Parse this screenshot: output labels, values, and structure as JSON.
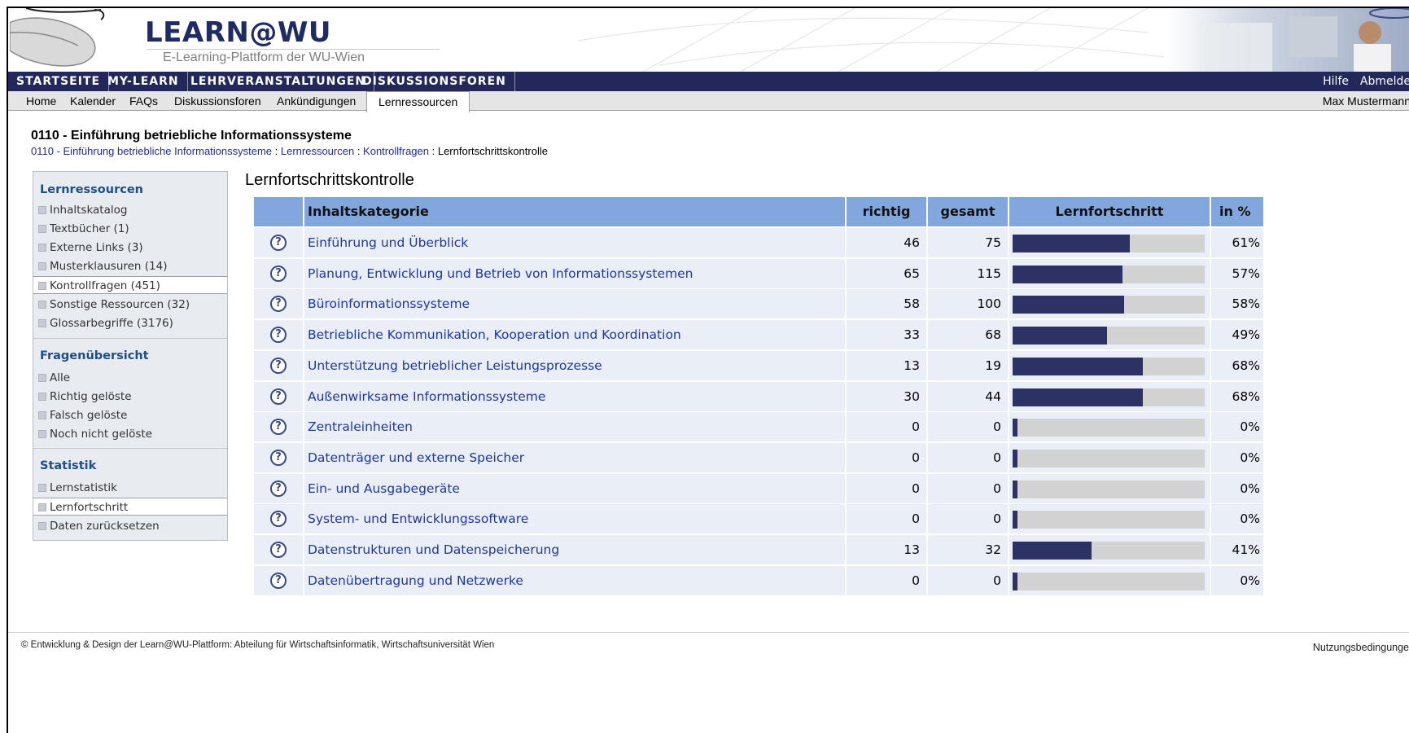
{
  "brand": {
    "title": "LEARN@WU",
    "subtitle": "E-Learning-Plattform der WU-Wien"
  },
  "mainnav": {
    "items": [
      "STARTSEITE",
      "MY-LEARN",
      "LEHRVERANSTALTUNGEN",
      "DISKUSSIONSFOREN"
    ],
    "help": "Hilfe",
    "logout": "Abmelde"
  },
  "subnav": {
    "items": [
      "Home",
      "Kalender",
      "FAQs",
      "Diskussionsforen",
      "Ankündigungen"
    ],
    "active": "Lernressourcen",
    "user": "Max Mustermann"
  },
  "page": {
    "course_title": "0110 - Einführung betriebliche Informationssysteme",
    "breadcrumb": {
      "links": [
        "0110 - Einführung betriebliche Informationssysteme",
        "Lernressourcen",
        "Kontrollfragen"
      ],
      "separator": " : ",
      "current": "Lernfortschrittskontrolle"
    },
    "content_title": "Lernfortschrittskontrolle"
  },
  "sidebar": {
    "lernressourcen": {
      "heading": "Lernressourcen",
      "items": [
        "Inhaltskatalog",
        "Textbücher (1)",
        "Externe Links (3)",
        "Musterklausuren (14)",
        "Kontrollfragen (451)",
        "Sonstige Ressourcen (32)",
        "Glossarbegriffe (3176)"
      ]
    },
    "fragen": {
      "heading": "Fragenübersicht",
      "items": [
        "Alle",
        "Richtig gelöste",
        "Falsch gelöste",
        "Noch nicht gelöste"
      ]
    },
    "statistik": {
      "heading": "Statistik",
      "items": [
        "Lernstatistik",
        "Lernfortschritt",
        "Daten zurücksetzen"
      ]
    }
  },
  "table": {
    "headers": {
      "category": "Inhaltskategorie",
      "correct": "richtig",
      "total": "gesamt",
      "progress": "Lernfortschritt",
      "percent": "in %"
    },
    "rows": [
      {
        "category": "Einführung und Überblick",
        "correct": "46",
        "total": "75",
        "percent": "61%",
        "progress": 0.61
      },
      {
        "category": "Planung, Entwicklung und Betrieb von Informationssystemen",
        "correct": "65",
        "total": "115",
        "percent": "57%",
        "progress": 0.57
      },
      {
        "category": "Büroinformationssysteme",
        "correct": "58",
        "total": "100",
        "percent": "58%",
        "progress": 0.58
      },
      {
        "category": "Betriebliche Kommunikation, Kooperation und Koordination",
        "correct": "33",
        "total": "68",
        "percent": "49%",
        "progress": 0.49
      },
      {
        "category": "Unterstützung betrieblicher Leistungsprozesse",
        "correct": "13",
        "total": "19",
        "percent": "68%",
        "progress": 0.68
      },
      {
        "category": "Außenwirksame Informationssysteme",
        "correct": "30",
        "total": "44",
        "percent": "68%",
        "progress": 0.68
      },
      {
        "category": "Zentraleinheiten",
        "correct": "0",
        "total": "0",
        "percent": "0%",
        "progress": 0
      },
      {
        "category": "Datenträger und externe Speicher",
        "correct": "0",
        "total": "0",
        "percent": "0%",
        "progress": 0
      },
      {
        "category": "Ein- und Ausgabegeräte",
        "correct": "0",
        "total": "0",
        "percent": "0%",
        "progress": 0
      },
      {
        "category": "System- und Entwicklungssoftware",
        "correct": "0",
        "total": "0",
        "percent": "0%",
        "progress": 0
      },
      {
        "category": "Datenstrukturen und Datenspeicherung",
        "correct": "13",
        "total": "32",
        "percent": "41%",
        "progress": 0.41
      },
      {
        "category": "Datenübertragung und Netzwerke",
        "correct": "0",
        "total": "0",
        "percent": "0%",
        "progress": 0
      }
    ]
  },
  "footer": {
    "left": "© Entwicklung & Design der Learn@WU-Plattform: Abteilung für Wirtschaftsinformatik, Wirtschaftsuniversität Wien",
    "right": "Nutzungsbedingunge"
  },
  "colors": {
    "nav_bg": "#22295a",
    "table_header": "#82a6de",
    "row_bg": "#e9eef7",
    "bar_fill": "#2c3264",
    "bar_track": "#d2d2d2",
    "link": "#1e35a8"
  },
  "icons": {
    "row_icon": "question-circle-icon",
    "bullet": "square-bullet-icon"
  }
}
